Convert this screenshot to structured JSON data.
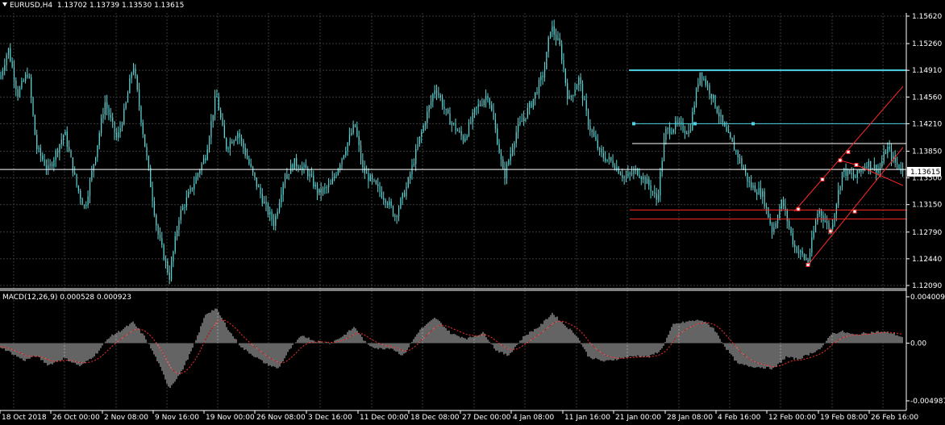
{
  "header": {
    "symbol": "EURUSD,H4",
    "ohlc": "1.13702 1.13739 1.13530 1.13615"
  },
  "macd": {
    "title": "MACD(12,26,9) 0.000528 0.000923",
    "axis_labels": [
      "0.004009",
      "0.00",
      "-0.004987"
    ]
  },
  "price_axis": {
    "labels": [
      "1.15620",
      "1.15260",
      "1.14910",
      "1.14560",
      "1.14210",
      "1.13850",
      "1.13500",
      "1.13150",
      "1.12790",
      "1.12440",
      "1.12090"
    ],
    "current_price": "1.13615"
  },
  "time_axis": {
    "labels": [
      "18 Oct 2018",
      "26 Oct 00:00",
      "2 Nov 08:00",
      "9 Nov 16:00",
      "19 Nov 00:00",
      "26 Nov 08:00",
      "3 Dec 16:00",
      "11 Dec 00:00",
      "18 Dec 08:00",
      "27 Dec 00:00",
      "4 Jan 08:00",
      "11 Jan 16:00",
      "21 Jan 00:00",
      "28 Jan 08:00",
      "4 Feb 16:00",
      "12 Feb 00:00",
      "19 Feb 08:00",
      "26 Feb 16:00"
    ]
  },
  "colors": {
    "background": "#000000",
    "candle": "#5fd3d3",
    "grid": "#3a3a3a",
    "aqua_line": "#4fd2e6",
    "red_line": "#ff2a2a",
    "white_line": "#ffffff",
    "macd_hist": "#c8c8c8",
    "macd_signal": "#ff3030"
  },
  "chart_data": {
    "type": "candlestick",
    "price_key_points": [
      [
        0,
        1.148
      ],
      [
        10,
        1.152
      ],
      [
        22,
        1.146
      ],
      [
        35,
        1.149
      ],
      [
        45,
        1.139
      ],
      [
        60,
        1.136
      ],
      [
        80,
        1.141
      ],
      [
        95,
        1.134
      ],
      [
        105,
        1.131
      ],
      [
        120,
        1.139
      ],
      [
        130,
        1.145
      ],
      [
        145,
        1.14
      ],
      [
        155,
        1.144
      ],
      [
        165,
        1.15
      ],
      [
        180,
        1.139
      ],
      [
        195,
        1.128
      ],
      [
        210,
        1.122
      ],
      [
        222,
        1.13
      ],
      [
        235,
        1.133
      ],
      [
        255,
        1.138
      ],
      [
        268,
        1.146
      ],
      [
        280,
        1.139
      ],
      [
        295,
        1.141
      ],
      [
        315,
        1.135
      ],
      [
        330,
        1.131
      ],
      [
        340,
        1.129
      ],
      [
        352,
        1.135
      ],
      [
        365,
        1.137
      ],
      [
        380,
        1.136
      ],
      [
        395,
        1.133
      ],
      [
        410,
        1.134
      ],
      [
        425,
        1.138
      ],
      [
        440,
        1.142
      ],
      [
        450,
        1.136
      ],
      [
        465,
        1.134
      ],
      [
        480,
        1.132
      ],
      [
        490,
        1.13
      ],
      [
        505,
        1.134
      ],
      [
        520,
        1.14
      ],
      [
        540,
        1.147
      ],
      [
        555,
        1.143
      ],
      [
        575,
        1.14
      ],
      [
        590,
        1.144
      ],
      [
        605,
        1.146
      ],
      [
        615,
        1.141
      ],
      [
        625,
        1.135
      ],
      [
        640,
        1.141
      ],
      [
        660,
        1.145
      ],
      [
        675,
        1.149
      ],
      [
        683,
        1.155
      ],
      [
        695,
        1.152
      ],
      [
        705,
        1.145
      ],
      [
        718,
        1.148
      ],
      [
        730,
        1.142
      ],
      [
        745,
        1.138
      ],
      [
        760,
        1.137
      ],
      [
        775,
        1.135
      ],
      [
        790,
        1.136
      ],
      [
        805,
        1.134
      ],
      [
        815,
        1.132
      ],
      [
        825,
        1.141
      ],
      [
        840,
        1.142
      ],
      [
        855,
        1.141
      ],
      [
        868,
        1.149
      ],
      [
        882,
        1.146
      ],
      [
        900,
        1.141
      ],
      [
        915,
        1.138
      ],
      [
        930,
        1.134
      ],
      [
        945,
        1.133
      ],
      [
        958,
        1.128
      ],
      [
        970,
        1.132
      ],
      [
        985,
        1.126
      ],
      [
        1002,
        1.124
      ],
      [
        1015,
        1.131
      ],
      [
        1030,
        1.128
      ],
      [
        1045,
        1.136
      ],
      [
        1060,
        1.135
      ],
      [
        1075,
        1.137
      ],
      [
        1090,
        1.136
      ],
      [
        1100,
        1.139
      ],
      [
        1110,
        1.137
      ],
      [
        1120,
        1.136
      ]
    ],
    "macd_key_points": [
      [
        0,
        -0.0003
      ],
      [
        15,
        -0.0009
      ],
      [
        30,
        -0.0015
      ],
      [
        45,
        -0.0011
      ],
      [
        60,
        -0.0019
      ],
      [
        80,
        -0.0013
      ],
      [
        100,
        -0.002
      ],
      [
        120,
        -0.0009
      ],
      [
        135,
        0.0005
      ],
      [
        150,
        0.0011
      ],
      [
        165,
        0.0018
      ],
      [
        180,
        0.0005
      ],
      [
        195,
        -0.0015
      ],
      [
        210,
        -0.0039
      ],
      [
        225,
        -0.0025
      ],
      [
        240,
        -0.0003
      ],
      [
        255,
        0.0025
      ],
      [
        268,
        0.003
      ],
      [
        285,
        0.001
      ],
      [
        300,
        -0.0004
      ],
      [
        315,
        -0.0011
      ],
      [
        330,
        -0.0018
      ],
      [
        345,
        -0.0022
      ],
      [
        360,
        -0.0005
      ],
      [
        375,
        0.0007
      ],
      [
        390,
        0.0002
      ],
      [
        410,
        0.0
      ],
      [
        425,
        0.0006
      ],
      [
        440,
        0.0014
      ],
      [
        455,
        -0.0001
      ],
      [
        470,
        -0.0005
      ],
      [
        485,
        -0.0004
      ],
      [
        500,
        -0.0011
      ],
      [
        520,
        0.0011
      ],
      [
        540,
        0.0022
      ],
      [
        560,
        0.0008
      ],
      [
        580,
        0.0004
      ],
      [
        600,
        0.0009
      ],
      [
        615,
        -0.0006
      ],
      [
        630,
        -0.0011
      ],
      [
        650,
        0.0006
      ],
      [
        670,
        0.0015
      ],
      [
        685,
        0.0026
      ],
      [
        700,
        0.0016
      ],
      [
        715,
        0.0007
      ],
      [
        730,
        -0.0012
      ],
      [
        750,
        -0.0016
      ],
      [
        770,
        -0.0013
      ],
      [
        790,
        -0.0011
      ],
      [
        805,
        -0.0012
      ],
      [
        820,
        -0.0006
      ],
      [
        835,
        0.0016
      ],
      [
        855,
        0.0019
      ],
      [
        870,
        0.002
      ],
      [
        885,
        0.0013
      ],
      [
        900,
        -0.0004
      ],
      [
        915,
        -0.0018
      ],
      [
        930,
        -0.002
      ],
      [
        945,
        -0.0021
      ],
      [
        960,
        -0.0022
      ],
      [
        975,
        -0.0012
      ],
      [
        990,
        -0.0014
      ],
      [
        1005,
        -0.0009
      ],
      [
        1020,
        -0.0004
      ],
      [
        1030,
        0.0008
      ],
      [
        1045,
        0.001
      ],
      [
        1060,
        0.0007
      ],
      [
        1075,
        0.0009
      ],
      [
        1090,
        0.001
      ],
      [
        1105,
        0.0009
      ],
      [
        1120,
        0.0005
      ]
    ],
    "y_range": [
      1.1209,
      1.1562
    ],
    "macd_range": [
      -0.004987,
      0.004009
    ],
    "objects": {
      "aqua_horizontal": 1.1491,
      "aqua_segment": 1.1421,
      "white_levels": [
        1.1395,
        1.1361
      ],
      "red_levels": [
        1.1308,
        1.1296
      ],
      "channel_lower": [
        [
          1002,
          1.1236
        ],
        [
          1120,
          1.139
        ]
      ],
      "channel_upper": [
        [
          985,
          1.1306
        ],
        [
          1120,
          1.147
        ]
      ],
      "channel_mid_pivots": [
        [
          1042,
          1.1373
        ],
        [
          1062,
          1.1367
        ],
        [
          1120,
          1.134
        ]
      ]
    }
  }
}
